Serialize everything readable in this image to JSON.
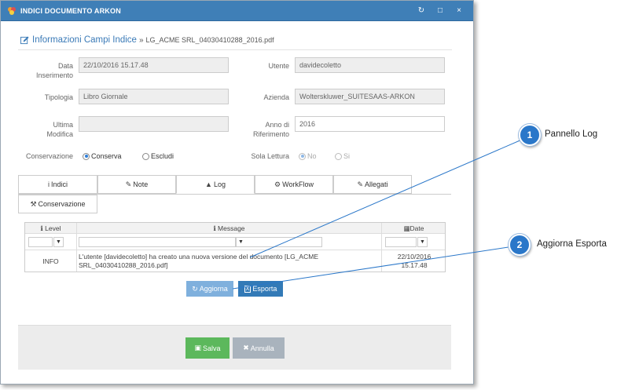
{
  "window": {
    "title": "INDICI DOCUMENTO ARKON",
    "controls": {
      "refresh": "↻",
      "maximize": "□",
      "close": "×"
    }
  },
  "heading": {
    "title": "Informazioni Campi Indice",
    "separator": "»",
    "filename": "LG_ACME SRL_04030410288_2016.pdf"
  },
  "form": {
    "data_inserimento_label_1": "Data",
    "data_inserimento_label_2": "Inserimento",
    "data_inserimento_value": "22/10/2016 15.17.48",
    "utente_label": "Utente",
    "utente_value": "davidecoletto",
    "tipologia_label": "Tipologia",
    "tipologia_value": "Libro Giornale",
    "azienda_label": "Azienda",
    "azienda_value": "Wolterskluwer_SUITESAAS-ARKON",
    "ultima_modifica_label_1": "Ultima",
    "ultima_modifica_label_2": "Modifica",
    "ultima_modifica_value": "",
    "anno_label_1": "Anno di",
    "anno_label_2": "Riferimento",
    "anno_value": "2016",
    "conservazione_label": "Conservazione",
    "conserva_option": "Conserva",
    "escludi_option": "Escludi",
    "sola_lettura_label": "Sola Lettura",
    "no_option": "No",
    "si_option": "Si"
  },
  "tabs": [
    {
      "label": "Indici",
      "icon": "i"
    },
    {
      "label": "Note",
      "icon": "✎"
    },
    {
      "label": "Log",
      "icon": "▲"
    },
    {
      "label": "WorkFlow",
      "icon": "⚙"
    },
    {
      "label": "Allegati",
      "icon": "✎"
    },
    {
      "label": "Conservazione",
      "icon": "⚒"
    }
  ],
  "grid": {
    "headers": {
      "level": "Level",
      "message": "Message",
      "date": "Date"
    },
    "rows": [
      {
        "level": "INFO",
        "message_1": "L'utente [davidecoletto] ha creato una nuova versione del documento [LG_ACME",
        "message_2": "SRL_04030410288_2016.pdf]",
        "date_1": "22/10/2016",
        "date_2": "15.17.48"
      }
    ]
  },
  "buttons": {
    "aggiorna": "Aggiorna",
    "esporta": "Esporta",
    "salva": "Salva",
    "annulla": "Annulla"
  },
  "callouts": [
    {
      "number": "1",
      "text": "Pannello Log"
    },
    {
      "number": "2",
      "text": "Aggiorna Esporta"
    }
  ],
  "colors": {
    "titlebar": "#3f7fb7",
    "accent": "#2a77c9",
    "aggiorna_button": "#7fb0dd",
    "esporta_button": "#337ab7",
    "salva_button": "#5cb85c",
    "annulla_button": "#a9b3bd"
  }
}
